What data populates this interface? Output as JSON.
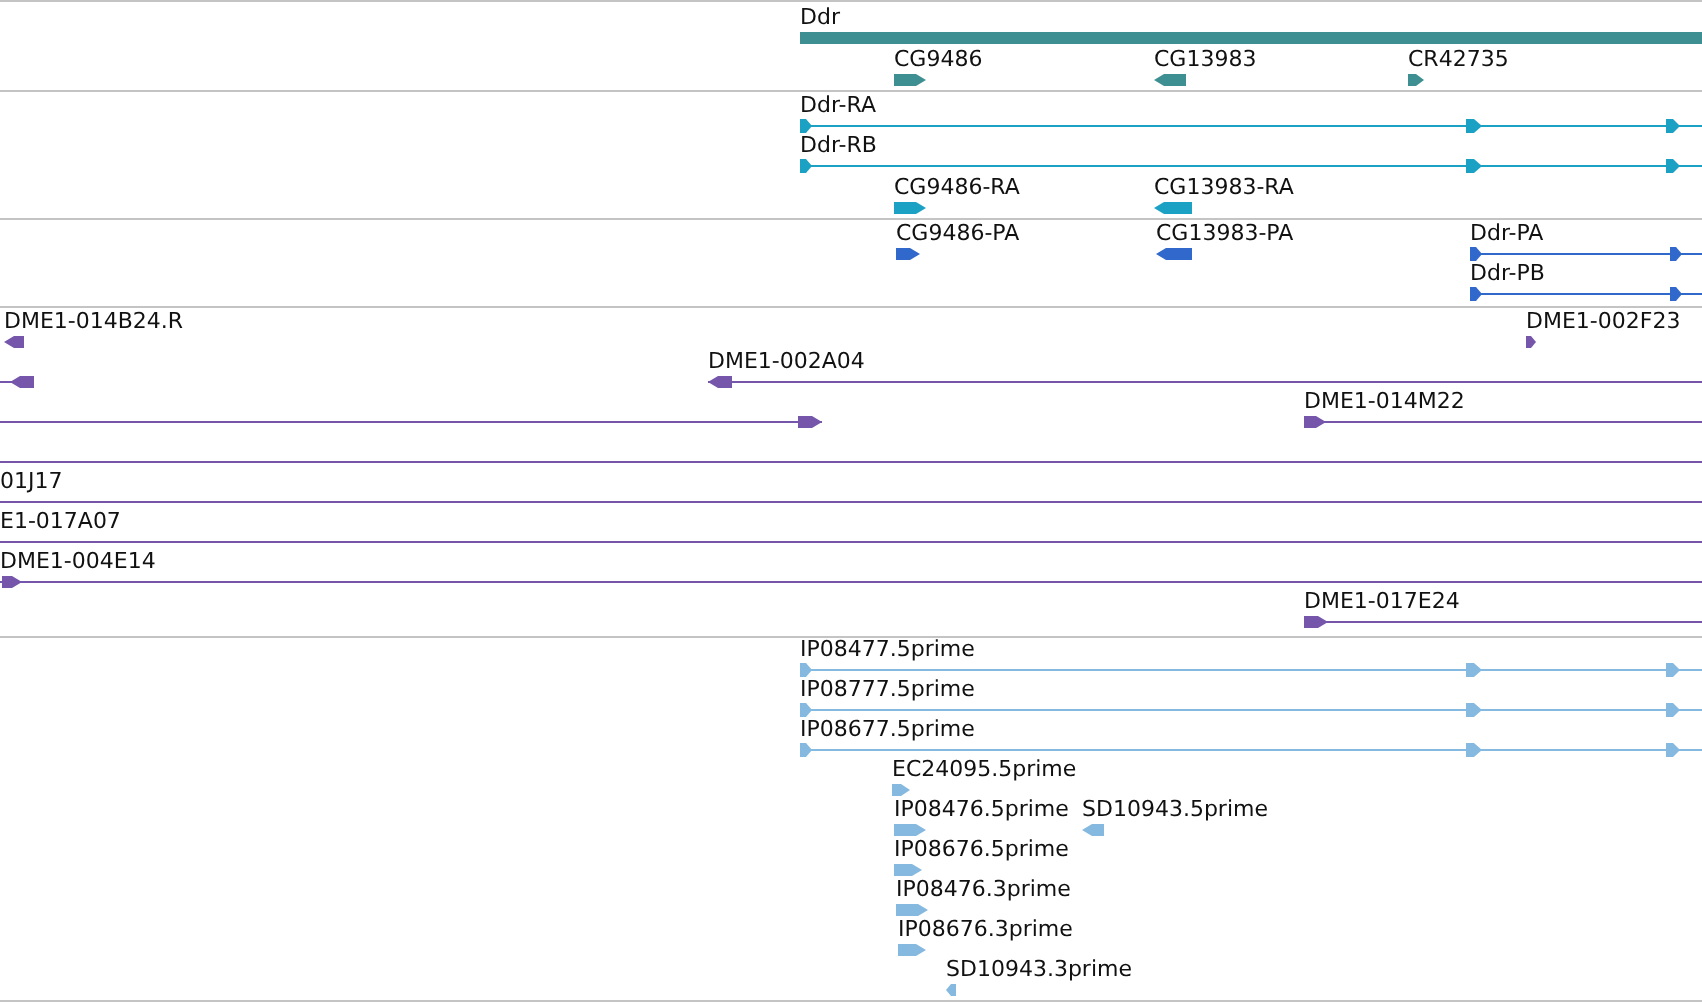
{
  "tracks": [
    {
      "color": "#3d8f91",
      "features": [
        {
          "kind": "bar",
          "label": "Ddr"
        },
        {
          "kind": "block",
          "label": "CG9486",
          "forward": true
        },
        {
          "kind": "block",
          "label": "CG13983",
          "forward": false
        },
        {
          "kind": "block",
          "label": "CR42735",
          "forward": true
        }
      ]
    },
    {
      "color": "#1ba1c3",
      "features": [
        {
          "kind": "line",
          "label": "Ddr-RA",
          "forward": true
        },
        {
          "kind": "line",
          "label": "Ddr-RB",
          "forward": true
        },
        {
          "kind": "block",
          "label": "CG9486-RA",
          "forward": true
        },
        {
          "kind": "block",
          "label": "CG13983-RA",
          "forward": false
        }
      ]
    },
    {
      "color": "#3068cc",
      "features": [
        {
          "kind": "block",
          "label": "CG9486-PA",
          "forward": true
        },
        {
          "kind": "block",
          "label": "CG13983-PA",
          "forward": false
        },
        {
          "kind": "line",
          "label": "Ddr-PA",
          "forward": true
        },
        {
          "kind": "line",
          "label": "Ddr-PB",
          "forward": true
        }
      ]
    },
    {
      "color": "#7656ab",
      "features": [
        {
          "kind": "block",
          "label": "DME1-014B24.R",
          "forward": false
        },
        {
          "kind": "block",
          "label": "DME1-002F23",
          "forward": true
        },
        {
          "kind": "line",
          "forward": false
        },
        {
          "kind": "line",
          "label": "DME1-002A04",
          "forward": false
        },
        {
          "kind": "line",
          "forward": true
        },
        {
          "kind": "line",
          "label": "DME1-014M22",
          "forward": true
        },
        {
          "kind": "line"
        },
        {
          "kind": "line",
          "label": "01J17"
        },
        {
          "kind": "line",
          "label": "E1-017A07"
        },
        {
          "kind": "line",
          "label": "DME1-004E14",
          "forward": true
        },
        {
          "kind": "line",
          "label": "DME1-017E24",
          "forward": true
        }
      ]
    },
    {
      "color": "#85b9e0",
      "features": [
        {
          "kind": "line",
          "label": "IP08477.5prime",
          "forward": true
        },
        {
          "kind": "line",
          "label": "IP08777.5prime",
          "forward": true
        },
        {
          "kind": "line",
          "label": "IP08677.5prime",
          "forward": true
        },
        {
          "kind": "block",
          "label": "EC24095.5prime",
          "forward": true
        },
        {
          "kind": "block",
          "label": "IP08476.5prime",
          "forward": true
        },
        {
          "kind": "block",
          "label": "SD10943.5prime",
          "forward": false
        },
        {
          "kind": "block",
          "label": "IP08676.5prime",
          "forward": true
        },
        {
          "kind": "block",
          "label": "IP08476.3prime",
          "forward": true
        },
        {
          "kind": "block",
          "label": "IP08676.3prime",
          "forward": true
        },
        {
          "kind": "block",
          "label": "SD10943.3prime",
          "forward": false
        }
      ]
    }
  ]
}
